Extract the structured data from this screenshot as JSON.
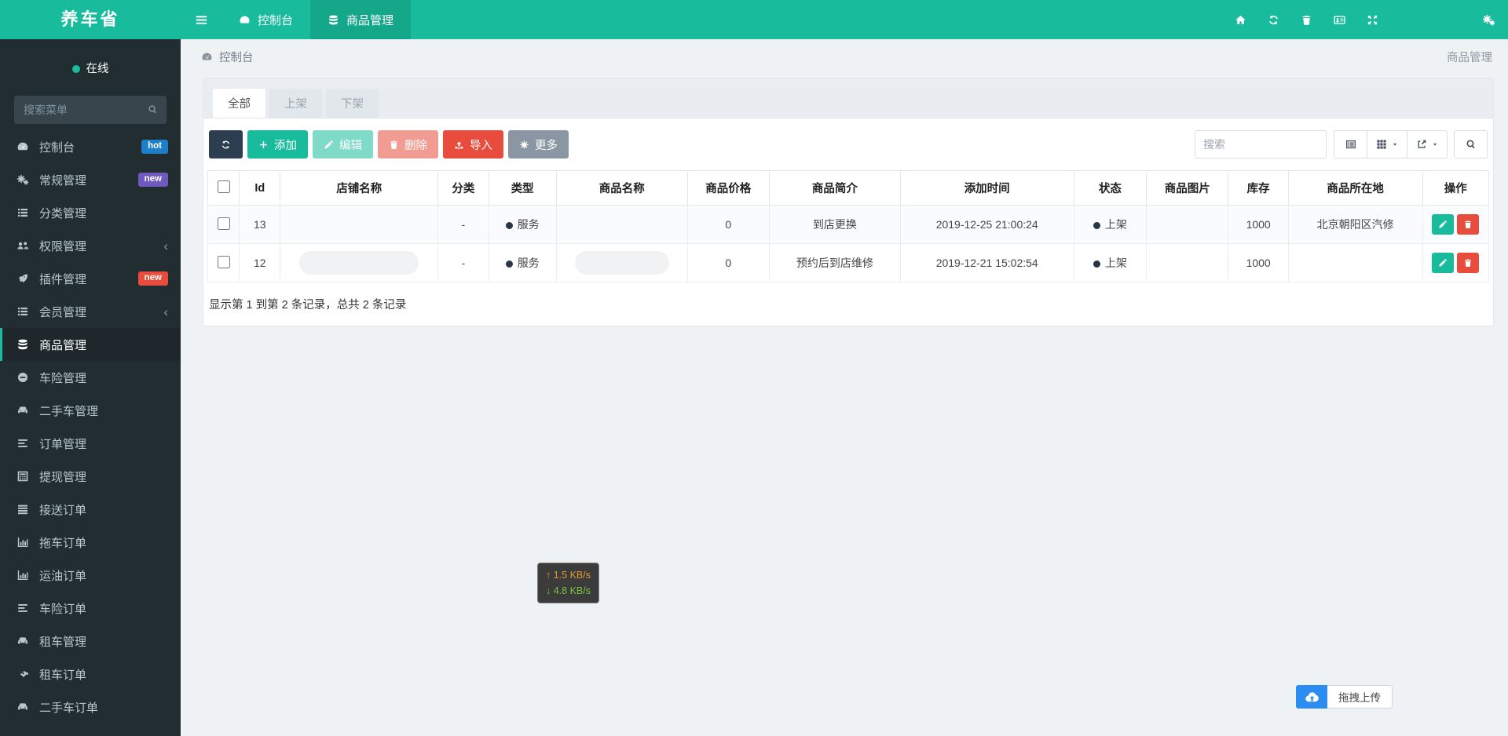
{
  "header": {
    "logo": "养车省",
    "tabs": [
      {
        "icon": "tachometer",
        "label": "控制台",
        "active": false
      },
      {
        "icon": "database",
        "label": "商品管理",
        "active": true
      }
    ],
    "right_icons": [
      "home",
      "refresh",
      "trash",
      "id-card",
      "expand"
    ],
    "settings_icon": "cogs"
  },
  "sidebar": {
    "status": {
      "label": "在线",
      "dot_color": "#1abc9c"
    },
    "search_placeholder": "搜索菜单",
    "items": [
      {
        "icon": "tachometer",
        "label": "控制台",
        "badge": {
          "text": "hot",
          "color": "#1d7fc9"
        }
      },
      {
        "icon": "gears",
        "label": "常规管理",
        "badge": {
          "text": "new",
          "color": "#6f5bc0"
        }
      },
      {
        "icon": "list",
        "label": "分类管理"
      },
      {
        "icon": "users",
        "label": "权限管理",
        "chevron": true
      },
      {
        "icon": "rocket",
        "label": "插件管理",
        "badge": {
          "text": "new",
          "color": "#e74c3c"
        }
      },
      {
        "icon": "list",
        "label": "会员管理",
        "chevron": true
      },
      {
        "icon": "database",
        "label": "商品管理",
        "active": true
      },
      {
        "icon": "minus-circle",
        "label": "车险管理"
      },
      {
        "icon": "car",
        "label": "二手车管理"
      },
      {
        "icon": "file-lines",
        "label": "订单管理"
      },
      {
        "icon": "calculator",
        "label": "提现管理"
      },
      {
        "icon": "bars",
        "label": "接送订单"
      },
      {
        "icon": "bar-chart",
        "label": "拖车订单"
      },
      {
        "icon": "bar-chart",
        "label": "运油订单"
      },
      {
        "icon": "file-lines",
        "label": "车险订单"
      },
      {
        "icon": "car",
        "label": "租车管理"
      },
      {
        "icon": "handshake",
        "label": "租车订单"
      },
      {
        "icon": "car",
        "label": "二手车订单"
      }
    ]
  },
  "breadcrumb": {
    "icon": "tachometer",
    "label": "控制台",
    "right_label": "商品管理"
  },
  "filter_tabs": [
    {
      "label": "全部",
      "active": true
    },
    {
      "label": "上架",
      "active": false
    },
    {
      "label": "下架",
      "active": false
    }
  ],
  "toolbar": {
    "buttons": [
      {
        "name": "refresh",
        "icon": "refresh",
        "label": "",
        "style": "dark",
        "disabled": false
      },
      {
        "name": "add",
        "icon": "plus",
        "label": "添加",
        "style": "success",
        "disabled": false
      },
      {
        "name": "edit",
        "icon": "pencil",
        "label": "编辑",
        "style": "success",
        "disabled": true
      },
      {
        "name": "delete",
        "icon": "trash",
        "label": "删除",
        "style": "danger",
        "disabled": true
      },
      {
        "name": "import",
        "icon": "upload",
        "label": "导入",
        "style": "danger",
        "disabled": false
      },
      {
        "name": "more",
        "icon": "gear",
        "label": "更多",
        "style": "secondary",
        "disabled": false
      }
    ],
    "search_placeholder": "搜索",
    "right_buttons": [
      {
        "name": "toggle-view",
        "icon": "table-list",
        "caret": false
      },
      {
        "name": "columns",
        "icon": "grid",
        "caret": true
      },
      {
        "name": "export",
        "icon": "export",
        "caret": true
      }
    ],
    "search_button_icon": "search"
  },
  "table": {
    "columns": [
      "Id",
      "店铺名称",
      "分类",
      "类型",
      "商品名称",
      "商品价格",
      "商品简介",
      "添加时间",
      "状态",
      "商品图片",
      "库存",
      "商品所在地",
      "操作"
    ],
    "rows": [
      {
        "id": "13",
        "shop": "",
        "shop_redacted": false,
        "category": "-",
        "type": "服务",
        "name": "",
        "name_redacted": false,
        "price": "0",
        "brief": "到店更换",
        "added": "2019-12-25 21:00:24",
        "status": "上架",
        "image": "",
        "stock": "1000",
        "location": "北京朝阳区汽修"
      },
      {
        "id": "12",
        "shop": "",
        "shop_redacted": true,
        "category": "-",
        "type": "服务",
        "name": "",
        "name_redacted": true,
        "price": "0",
        "brief": "预约后到店维修",
        "added": "2019-12-21 15:02:54",
        "status": "上架",
        "image": "",
        "stock": "1000",
        "location": ""
      }
    ],
    "summary": "显示第 1 到第 2 条记录，总共 2 条记录"
  },
  "net_monitor": {
    "up": "↑ 1.5 KB/s",
    "down": "↓ 4.8 KB/s",
    "up_color": "#e09a32",
    "down_color": "#7cc343"
  },
  "upload": {
    "label": "拖拽上传",
    "icon": "cloud-upload",
    "icon_bg": "#2d8cf0"
  },
  "colors": {
    "primary": "#18bc9c",
    "danger": "#e74c3c",
    "dark": "#2c3e50",
    "sidebar_bg": "#222d32",
    "status_dot": "#2a3642"
  }
}
